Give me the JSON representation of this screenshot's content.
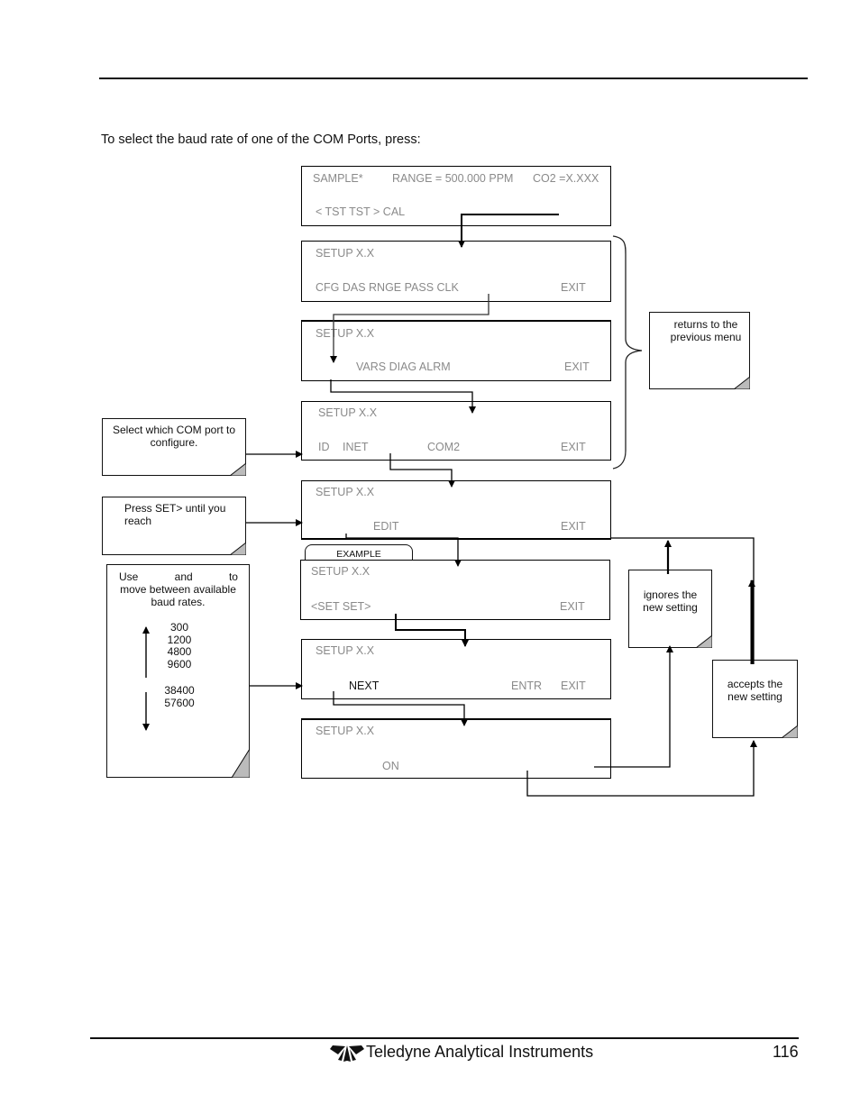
{
  "page": {
    "intro": "To select the baud rate of one of the COM Ports, press:",
    "footer": {
      "company": "Teledyne Analytical Instruments",
      "page_number": "116",
      "logo_icon": "teledyne-logo-icon"
    }
  },
  "screens": [
    {
      "line1": "SAMPLE*",
      "line1b": "RANGE = 500.000 PPM",
      "line1c": "CO2 =X.XXX",
      "line2": "< TST  TST >  CAL"
    },
    {
      "line1": "SETUP X.X",
      "line2": "CFG  DAS  RNGE  PASS  CLK",
      "exit": "EXIT"
    },
    {
      "line1": "SETUP X.X",
      "line2": "VARS   DIAG   ALRM",
      "exit": "EXIT"
    },
    {
      "line1": "SETUP X.X",
      "line2a": "ID",
      "line2b": "INET",
      "line2c": "COM2",
      "exit": "EXIT"
    },
    {
      "line1": "SETUP X.X",
      "line2": "EDIT",
      "exit": "EXIT"
    },
    {
      "line1": "SETUP X.X",
      "line2": "<SET  SET>",
      "exit": "EXIT",
      "tab": "EXAMPLE"
    },
    {
      "line1": "SETUP X.X",
      "line2": "NEXT",
      "entr": "ENTR",
      "exit": "EXIT"
    },
    {
      "line1": "SETUP X.X",
      "line2": "ON"
    }
  ],
  "notes": {
    "returns": "returns to the previous menu",
    "select_com": "Select which COM port to configure.",
    "press_set": "Press SET> until you reach",
    "use_move": {
      "w1": "Use",
      "w2": "and",
      "w3": "to",
      "rest": "move between available baud rates."
    },
    "baud_rates_upper": [
      "300",
      "1200",
      "4800",
      "9600"
    ],
    "baud_rates_lower": [
      "38400",
      "57600"
    ],
    "ignores": "ignores the new setting",
    "accepts": "accepts the new setting"
  }
}
